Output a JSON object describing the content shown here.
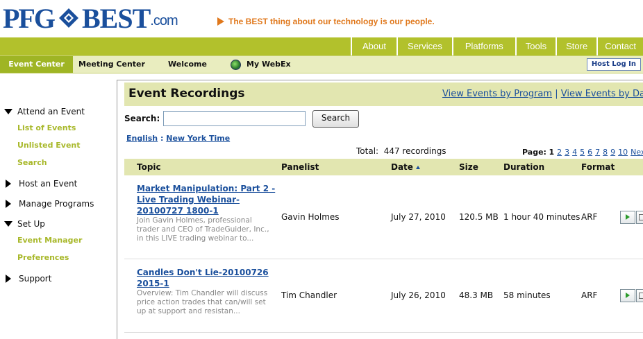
{
  "header": {
    "logo_pfg": "PFG",
    "logo_best": "BEST",
    "logo_com": ".com",
    "tagline": "The BEST thing about our technology is our people."
  },
  "top_nav": [
    "About",
    "Services",
    "Platforms",
    "Tools",
    "Store",
    "Contact"
  ],
  "tabs": {
    "event_center": "Event Center",
    "meeting_center": "Meeting Center",
    "welcome": "Welcome",
    "my_webex": "My WebEx",
    "host_login": "Host Log In"
  },
  "sidebar": {
    "attend": "Attend an Event",
    "list_events": "List of Events",
    "unlisted_event": "Unlisted Event",
    "search": "Search",
    "host": "Host an Event",
    "manage": "Manage Programs",
    "setup": "Set Up",
    "event_manager": "Event Manager",
    "preferences": "Preferences",
    "support": "Support"
  },
  "main": {
    "title": "Event Recordings",
    "view_by_program": "View Events by Program",
    "separator": "|",
    "view_by_date": "View Events by Date",
    "search_label": "Search:",
    "search_value": "",
    "search_button": "Search",
    "language": "English",
    "lang_sep": ":",
    "timezone": "New York Time",
    "total": "Total:  447 recordings",
    "page_label": "Page:",
    "current_page": "1",
    "pages": [
      "2",
      "3",
      "4",
      "5",
      "6",
      "7",
      "8",
      "9",
      "10",
      "Next"
    ]
  },
  "table": {
    "headers": {
      "topic": "Topic",
      "panelist": "Panelist",
      "date": "Date",
      "size": "Size",
      "duration": "Duration",
      "format": "Format"
    },
    "rows": [
      {
        "topic": "Market Manipulation: Part 2 - Live Trading Webinar-20100727 1800-1",
        "description": "Join Gavin Holmes, professional trader and CEO of TradeGuider, Inc., in this LIVE trading webinar to...",
        "panelist": "Gavin Holmes",
        "date": "July 27, 2010",
        "size": "120.5 MB",
        "duration": "1 hour 40 minutes",
        "format": "ARF"
      },
      {
        "topic": "Candles Don't Lie-20100726 2015-1",
        "description": "Overview: Tim Chandler will discuss price action trades that can/will set up at support and resistan...",
        "panelist": "Tim Chandler",
        "date": "July 26, 2010",
        "size": "48.3 MB",
        "duration": "58 minutes",
        "format": "ARF"
      }
    ]
  },
  "colors": {
    "brand_blue": "#1a4f9c",
    "nav_green": "#b2c12c",
    "accent_orange": "#e0781c",
    "header_band": "#e2e6b0"
  }
}
